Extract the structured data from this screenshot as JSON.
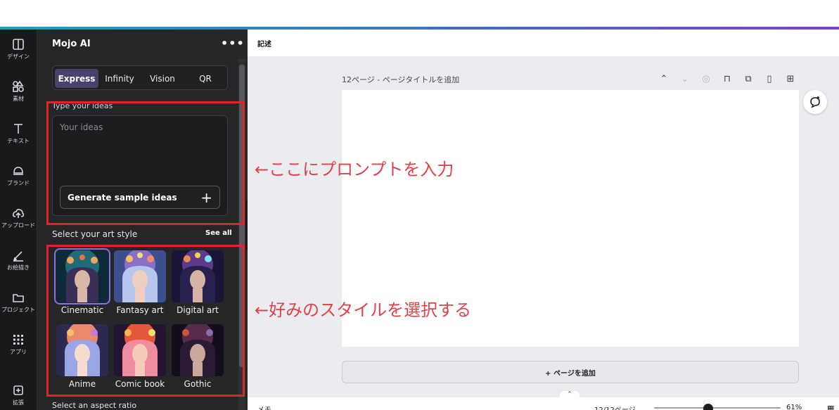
{
  "rail": {
    "items": [
      {
        "label": "デザイン",
        "icon": "layout-icon"
      },
      {
        "label": "素材",
        "icon": "elements-icon"
      },
      {
        "label": "テキスト",
        "icon": "text-icon"
      },
      {
        "label": "ブランド",
        "icon": "brand-icon"
      },
      {
        "label": "アップロード",
        "icon": "upload-icon"
      },
      {
        "label": "お絵描き",
        "icon": "draw-icon"
      },
      {
        "label": "プロジェクト",
        "icon": "folder-icon"
      },
      {
        "label": "アプリ",
        "icon": "apps-icon"
      },
      {
        "label": "拡張",
        "icon": "extend-icon"
      }
    ]
  },
  "panel": {
    "title": "Mojo AI",
    "more": "•••",
    "tabs": [
      {
        "label": "Express",
        "active": true
      },
      {
        "label": "Infinity",
        "active": false
      },
      {
        "label": "Vision",
        "active": false
      },
      {
        "label": "QR",
        "active": false
      }
    ],
    "ideas_label": "Type your ideas",
    "ideas_placeholder": "Your ideas",
    "generate_label": "Generate sample ideas",
    "generate_plus": "+",
    "style_label": "Select your art style",
    "see_all": "See all",
    "styles": [
      {
        "name": "Cinematic",
        "selected": true
      },
      {
        "name": "Fantasy art",
        "selected": false
      },
      {
        "name": "Digital art",
        "selected": false
      },
      {
        "name": "Anime",
        "selected": false
      },
      {
        "name": "Comic book",
        "selected": false
      },
      {
        "name": "Gothic",
        "selected": false
      }
    ],
    "aspect_label": "Select an aspect ratio"
  },
  "annotations": {
    "prompt": "←ここにプロンプトを入力",
    "style": "←好みのスタイルを選択する"
  },
  "editor": {
    "header_tag": "記述",
    "page_title": "12ページ - ページタイトルを追加",
    "add_page": "+ ページを追加",
    "memo": "メモ",
    "page_count": "12/12ページ",
    "zoom": "61%",
    "comment_icon": "comment-add-icon"
  },
  "colors": {
    "accent": "#49426d",
    "annotation_red": "#e0242c",
    "panel_bg": "#252627",
    "rail_bg": "#18191b"
  }
}
